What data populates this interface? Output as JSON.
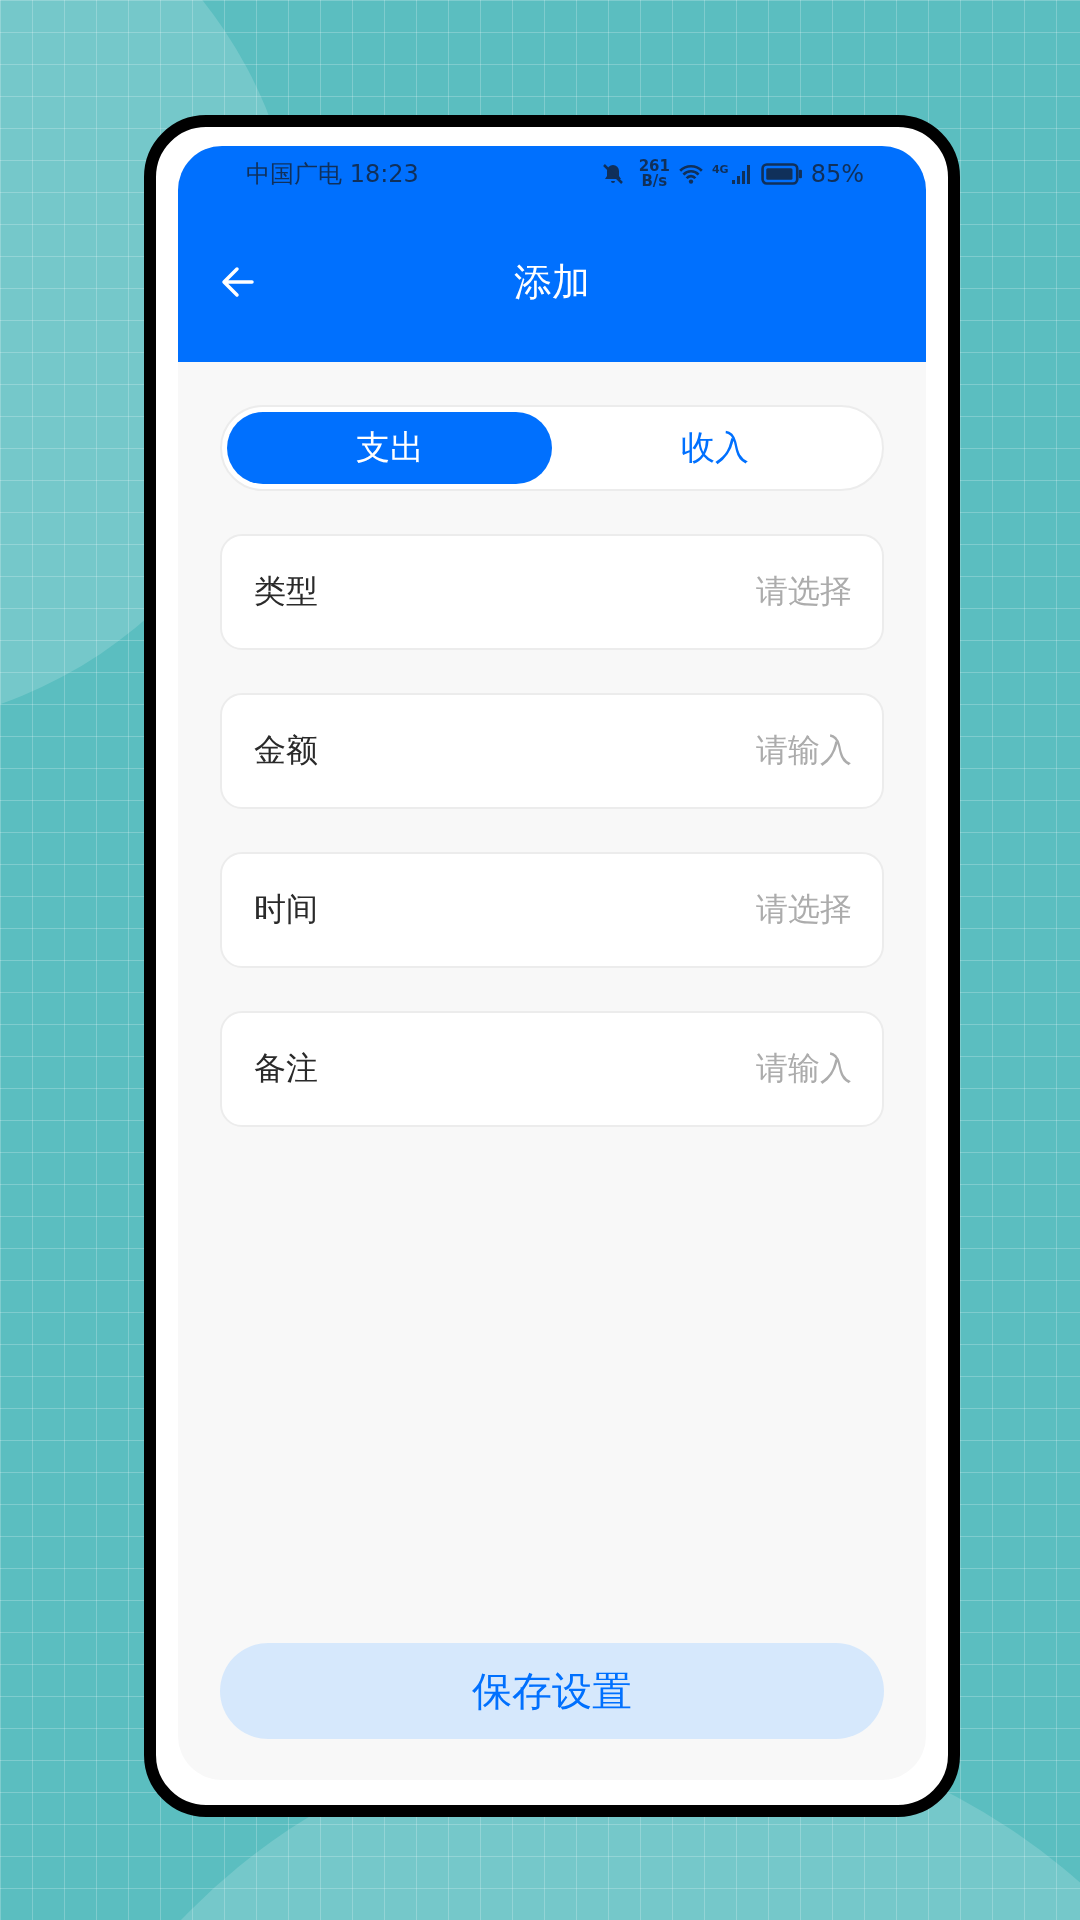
{
  "status_bar": {
    "carrier_time": "中国广电 18:23",
    "net_speed_value": "261",
    "net_speed_unit": "B/s",
    "network_type": "4G",
    "battery": "85%"
  },
  "header": {
    "title": "添加"
  },
  "tabs": [
    {
      "label": "支出",
      "selected": true
    },
    {
      "label": "收入",
      "selected": false
    }
  ],
  "fields": [
    {
      "label": "类型",
      "placeholder": "请选择"
    },
    {
      "label": "金额",
      "placeholder": "请输入"
    },
    {
      "label": "时间",
      "placeholder": "请选择"
    },
    {
      "label": "备注",
      "placeholder": "请输入"
    }
  ],
  "save_button": "保存设置"
}
